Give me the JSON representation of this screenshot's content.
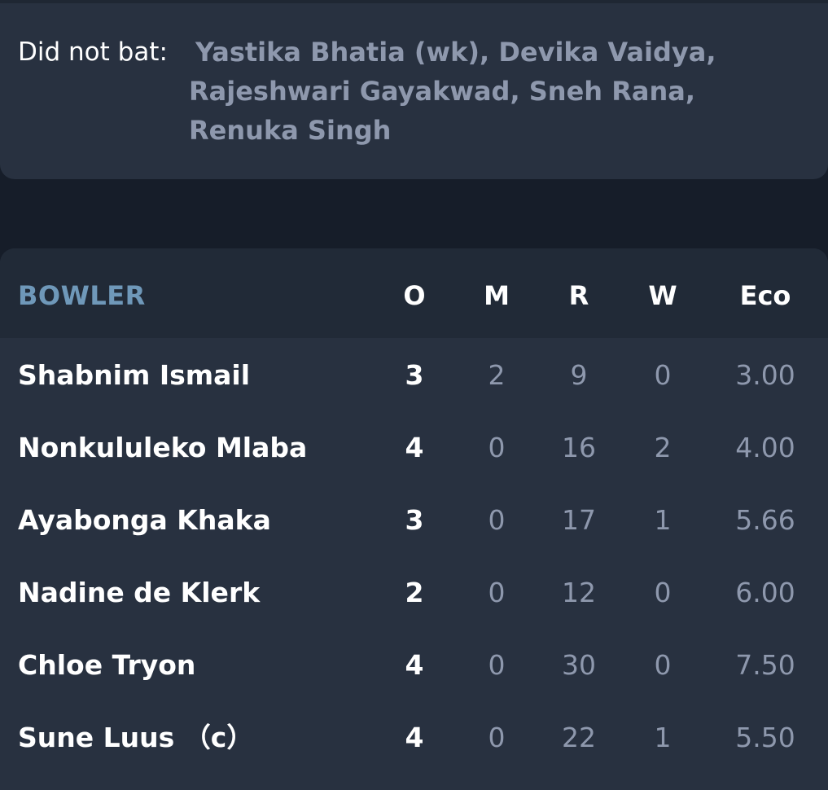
{
  "did_not_bat": {
    "label": "Did not bat:",
    "players": "Yastika Bhatia (wk), Devika Vaidya, Rajeshwari Gayakwad, Sneh Rana, Renuka Singh"
  },
  "bowling": {
    "headers": {
      "bowler": "BOWLER",
      "overs": "O",
      "maidens": "M",
      "runs": "R",
      "wickets": "W",
      "economy": "Eco"
    },
    "rows": [
      {
        "name": "Shabnim Ismail",
        "overs": "3",
        "maidens": "2",
        "runs": "9",
        "wickets": "0",
        "economy": "3.00"
      },
      {
        "name": "Nonkululeko Mlaba",
        "overs": "4",
        "maidens": "0",
        "runs": "16",
        "wickets": "2",
        "economy": "4.00"
      },
      {
        "name": "Ayabonga Khaka",
        "overs": "3",
        "maidens": "0",
        "runs": "17",
        "wickets": "1",
        "economy": "5.66"
      },
      {
        "name": "Nadine de Klerk",
        "overs": "2",
        "maidens": "0",
        "runs": "12",
        "wickets": "0",
        "economy": "6.00"
      },
      {
        "name": "Chloe Tryon",
        "overs": "4",
        "maidens": "0",
        "runs": "30",
        "wickets": "0",
        "economy": "7.50"
      },
      {
        "name": "Sune Luus （c）",
        "overs": "4",
        "maidens": "0",
        "runs": "22",
        "wickets": "1",
        "economy": "5.50"
      }
    ]
  }
}
